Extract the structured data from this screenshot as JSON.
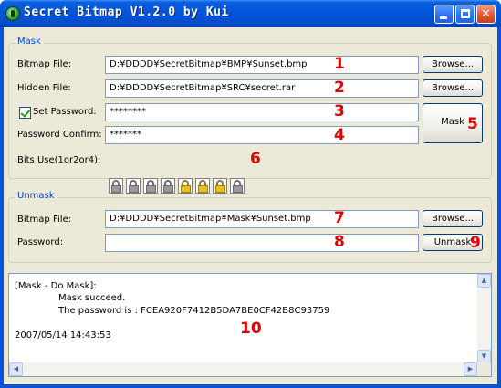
{
  "window": {
    "title": "Secret Bitmap V1.2.0 by Kui"
  },
  "mask": {
    "group_title": "Mask",
    "bitmap_label": "Bitmap File:",
    "bitmap_value": "D:¥DDDD¥SecretBitmap¥BMP¥Sunset.bmp",
    "hidden_label": "Hidden File:",
    "hidden_value": "D:¥DDDD¥SecretBitmap¥SRC¥secret.rar",
    "set_password_label": "Set Password:",
    "set_password_checked": true,
    "password_value": "********",
    "confirm_label": "Password Confirm:",
    "confirm_value": "*******",
    "browse_label": "Browse...",
    "mask_button": "Mask",
    "bits_label": "Bits Use(1or2or4):",
    "bits": [
      "off",
      "off",
      "off",
      "off",
      "on",
      "on",
      "on",
      "off"
    ]
  },
  "unmask": {
    "group_title": "Unmask",
    "bitmap_label": "Bitmap File:",
    "bitmap_value": "D:¥DDDD¥SecretBitmap¥Mask¥Sunset.bmp",
    "password_label": "Password:",
    "password_value": "",
    "browse_label": "Browse...",
    "unmask_button": "Unmask"
  },
  "log": {
    "lines": [
      "[Mask - Do Mask]:",
      "Mask succeed.",
      "The password is : FCEA920F7412B5DA7BE0CF42B8C93759",
      "2007/05/14  14:43:53"
    ]
  },
  "annotations": [
    "1",
    "2",
    "3",
    "4",
    "5",
    "6",
    "7",
    "8",
    "9",
    "10"
  ],
  "colors": {
    "titlebar": "#0554d8",
    "group_title": "#0046d5",
    "annotation": "#e10000",
    "client": "#ece9d8"
  }
}
